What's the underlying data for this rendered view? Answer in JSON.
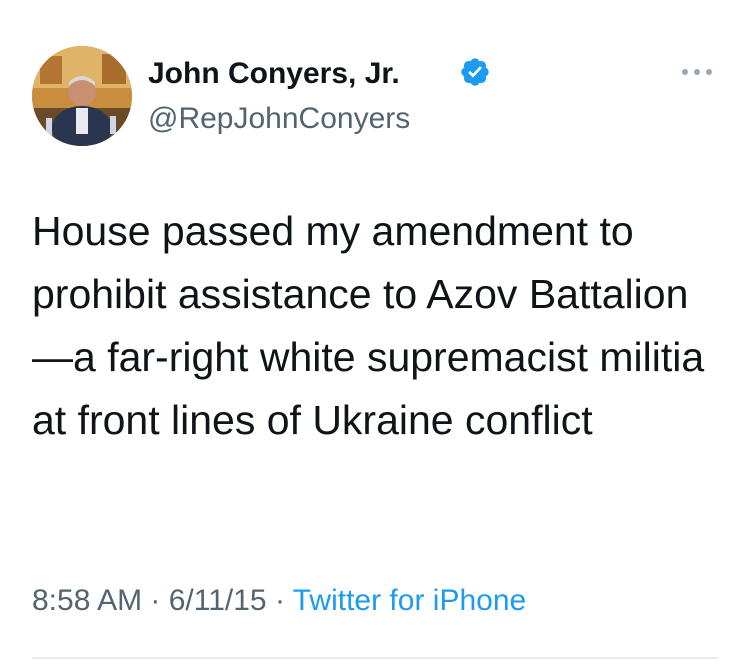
{
  "tweet": {
    "display_name": "John Conyers, Jr.",
    "handle": "@RepJohnConyers",
    "verified": true,
    "text": "House passed my amendment to prohibit assistance to Azov Battalion—a far-right white supremacist militia at front lines of Ukraine conflict",
    "time": "8:58 AM",
    "separator_1": " · ",
    "date": "6/11/15",
    "separator_2": " · ",
    "source": "Twitter for iPhone"
  },
  "icons": {
    "verified": "verified-badge-icon",
    "more": "more-options-icon"
  },
  "colors": {
    "text": "#0f1419",
    "secondary": "#536471",
    "link": "#1d9bf0",
    "verified": "#1d9bf0"
  }
}
